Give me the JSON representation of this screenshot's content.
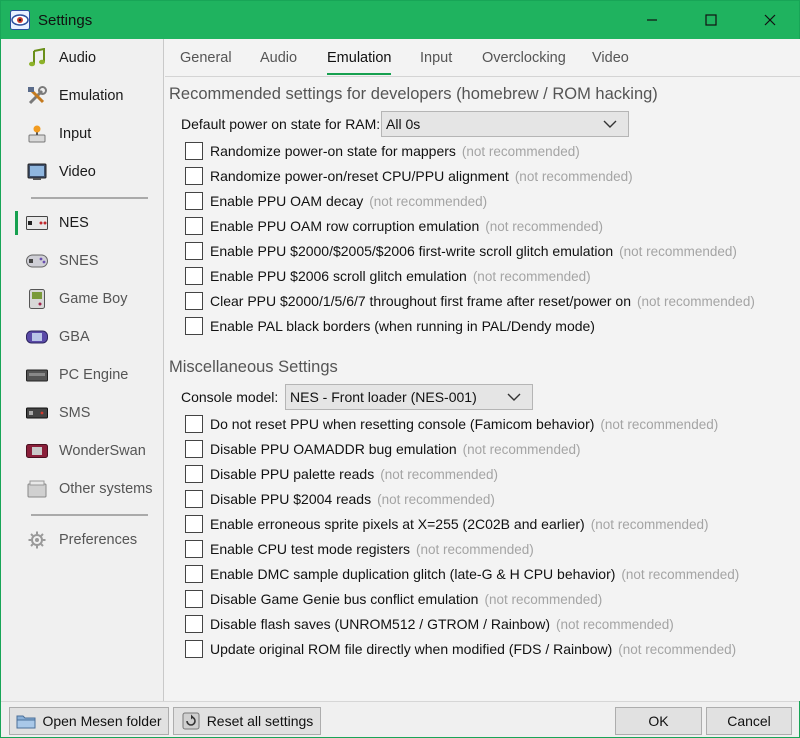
{
  "window": {
    "title": "Settings",
    "minimize_glyph": "—",
    "maximize_glyph": "☐",
    "close_glyph": "✕"
  },
  "sidebar": {
    "items": [
      {
        "label": "Audio",
        "icon": "audio-icon"
      },
      {
        "label": "Emulation",
        "icon": "emulation-icon"
      },
      {
        "label": "Input",
        "icon": "input-icon"
      },
      {
        "label": "Video",
        "icon": "video-icon"
      },
      {
        "label": "NES",
        "icon": "nes-icon",
        "active": true
      },
      {
        "label": "SNES",
        "icon": "snes-icon"
      },
      {
        "label": "Game Boy",
        "icon": "gameboy-icon"
      },
      {
        "label": "GBA",
        "icon": "gba-icon"
      },
      {
        "label": "PC Engine",
        "icon": "pcengine-icon"
      },
      {
        "label": "SMS",
        "icon": "sms-icon"
      },
      {
        "label": "WonderSwan",
        "icon": "wonderswan-icon"
      },
      {
        "label": "Other systems",
        "icon": "other-systems-icon"
      },
      {
        "label": "Preferences",
        "icon": "preferences-icon"
      }
    ]
  },
  "tabs": [
    {
      "label": "General"
    },
    {
      "label": "Audio"
    },
    {
      "label": "Emulation",
      "active": true
    },
    {
      "label": "Input"
    },
    {
      "label": "Overclocking"
    },
    {
      "label": "Video"
    }
  ],
  "developer": {
    "title": "Recommended settings for developers (homebrew / ROM hacking)",
    "ram_label": "Default power on state for RAM:",
    "ram_value": "All 0s",
    "options": [
      {
        "label": "Randomize power-on state for mappers",
        "note": "(not recommended)"
      },
      {
        "label": "Randomize power-on/reset CPU/PPU alignment",
        "note": "(not recommended)"
      },
      {
        "label": "Enable PPU OAM decay",
        "note": "(not recommended)"
      },
      {
        "label": "Enable PPU OAM row corruption emulation",
        "note": "(not recommended)"
      },
      {
        "label": "Enable PPU $2000/$2005/$2006 first-write scroll glitch emulation",
        "note": "(not recommended)"
      },
      {
        "label": "Enable PPU $2006 scroll glitch emulation",
        "note": "(not recommended)"
      },
      {
        "label": "Clear PPU $2000/1/5/6/7 throughout first frame after reset/power on",
        "note": "(not recommended)"
      },
      {
        "label": "Enable PAL black borders (when running in PAL/Dendy mode)",
        "note": ""
      }
    ]
  },
  "misc": {
    "title": "Miscellaneous Settings",
    "console_label": "Console model:",
    "console_value": "NES - Front loader (NES-001)",
    "options": [
      {
        "label": "Do not reset PPU when resetting console (Famicom behavior)",
        "note": "(not recommended)"
      },
      {
        "label": "Disable PPU OAMADDR bug emulation",
        "note": "(not recommended)"
      },
      {
        "label": "Disable PPU palette reads",
        "note": "(not recommended)"
      },
      {
        "label": "Disable PPU $2004 reads",
        "note": "(not recommended)"
      },
      {
        "label": "Enable erroneous sprite pixels at X=255 (2C02B and earlier)",
        "note": "(not recommended)"
      },
      {
        "label": "Enable CPU test mode registers",
        "note": "(not recommended)"
      },
      {
        "label": "Enable DMC sample duplication glitch (late-G & H CPU behavior)",
        "note": "(not recommended)"
      },
      {
        "label": "Disable Game Genie bus conflict emulation",
        "note": "(not recommended)"
      },
      {
        "label": "Disable flash saves (UNROM512 / GTROM / Rainbow)",
        "note": "(not recommended)"
      },
      {
        "label": "Update original ROM file directly when modified (FDS / Rainbow)",
        "note": "(not recommended)"
      }
    ]
  },
  "footer": {
    "open_folder": "Open Mesen folder",
    "reset_all": "Reset all settings",
    "ok": "OK",
    "cancel": "Cancel"
  },
  "colors": {
    "accent": "#1fb35f",
    "active_indicator": "#16a04f",
    "muted_note": "#a4a4a4"
  }
}
